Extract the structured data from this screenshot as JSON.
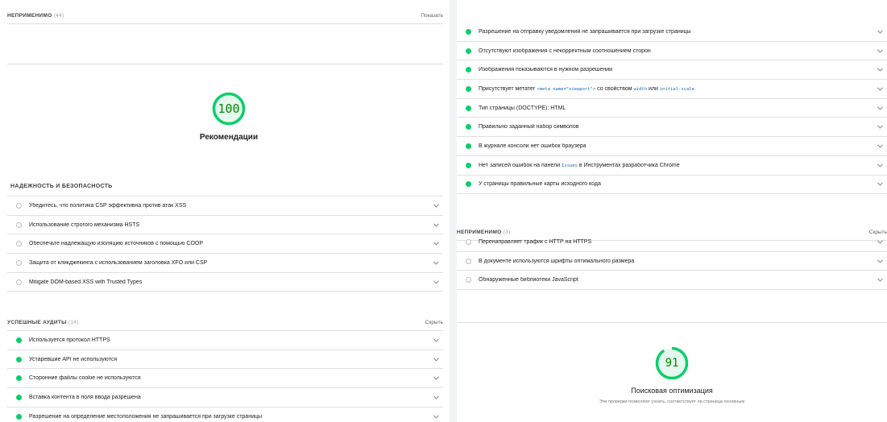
{
  "left": {
    "na_top": {
      "title": "НЕПРИМЕНИМО",
      "count": "(44)",
      "toggle": "Показать"
    },
    "gauge": {
      "score": "100",
      "value": 100,
      "label": "Рекомендации"
    },
    "security": {
      "title": "НАДЕЖНОСТЬ И БЕЗОПАСНОСТЬ",
      "items": [
        "Убедитесь, что политика CSP эффективна против атак XSS",
        "Использование строгого механизма HSTS",
        "Обеспечьте надлежащую изоляцию источников с помощью COOP",
        "Защита от кликджекинга с использованием заголовка XFO или CSP",
        "Mitigate DOM-based XSS with Trusted Types"
      ]
    },
    "passed": {
      "title": "УСПЕШНЫЕ АУДИТЫ",
      "count": "(14)",
      "toggle": "Скрыть",
      "items": [
        "Используется протокол HTTPS",
        "Устаревшие API не используются",
        "Сторонние файлы cookie не используются",
        "Вставка контента в поля ввода разрешена",
        "Разрешение на определение местоположения не запрашивается при загрузке страницы"
      ]
    }
  },
  "right": {
    "passed_items": {
      "i0": "Разрешение на отправку уведомлений не запрашивается при загрузке страницы",
      "i1": "Отсутствуют изображения с некорректным соотношением сторон",
      "i2": "Изображения показываются в нужном разрешении",
      "i3": {
        "before": "Присутствует метатег ",
        "code1": "<meta name=\"viewport\">",
        "mid": " со свойством ",
        "code2": "width",
        "or": " или ",
        "code3": "initial-scale"
      },
      "i4": "Тип страницы (DOCTYPE): HTML",
      "i5": "Правильно заданный набор символов",
      "i6": "В журнале консоли нет ошибок браузера",
      "i7": {
        "before": "Нет записей ошибок на панели ",
        "code": "Issues",
        "after": " в Инструментах разработчика Chrome"
      },
      "i8": "У страницы правильные карты исходного кода"
    },
    "na": {
      "title": "НЕПРИМЕНИМО",
      "count": "(3)",
      "toggle": "Скрыть",
      "items": [
        "Перенаправляет трафик с HTTP на HTTPS",
        "В документе используются шрифты оптимального размера",
        "Обнаруженные библиотеки JavaScript"
      ]
    },
    "gauge": {
      "score": "91",
      "value": 91,
      "label": "Поисковая оптимизация",
      "desc": "Эти проверки позволяют узнать, соответствует ли страница основным"
    }
  },
  "colors": {
    "pass": "#0cce6b",
    "gauge_stroke": "#0cce6b",
    "gauge_fill": "#e5f8ee",
    "gauge_text": "#008800"
  },
  "icons": {
    "expand": "chevron-down-icon",
    "pass": "pass-dot-icon",
    "na": "na-circle-icon"
  }
}
